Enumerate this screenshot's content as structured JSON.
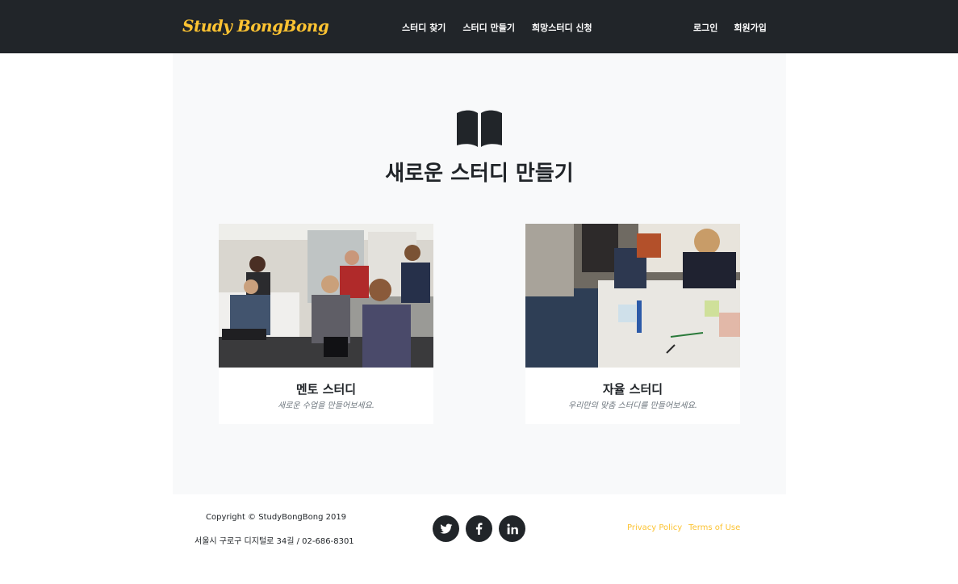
{
  "navbar": {
    "brand": "Study BongBong",
    "menu": [
      {
        "label": "스터디 찾기"
      },
      {
        "label": "스터디 만들기"
      },
      {
        "label": "희망스터디 신청"
      }
    ],
    "auth": {
      "login": "로그인",
      "signup": "회원가입"
    }
  },
  "main": {
    "icon": "book-open-icon",
    "title": "새로운 스터디 만들기",
    "cards": [
      {
        "title": "멘토 스터디",
        "subtitle": "새로운 수업을 만들어보세요."
      },
      {
        "title": "자율 스터디",
        "subtitle": "우리만의 맞춤 스터디를 만들어보세요."
      }
    ]
  },
  "footer": {
    "copyright": "Copyright © StudyBongBong 2019",
    "address": "서울시 구로구 디지털로 34길 / 02-686-8301",
    "social": [
      "twitter-icon",
      "facebook-icon",
      "linkedin-icon"
    ],
    "links": {
      "privacy": "Privacy Policy",
      "terms": "Terms of Use"
    }
  },
  "colors": {
    "navbar_bg": "#212529",
    "accent": "#fcc332",
    "section_bg": "#f8f9fa"
  }
}
